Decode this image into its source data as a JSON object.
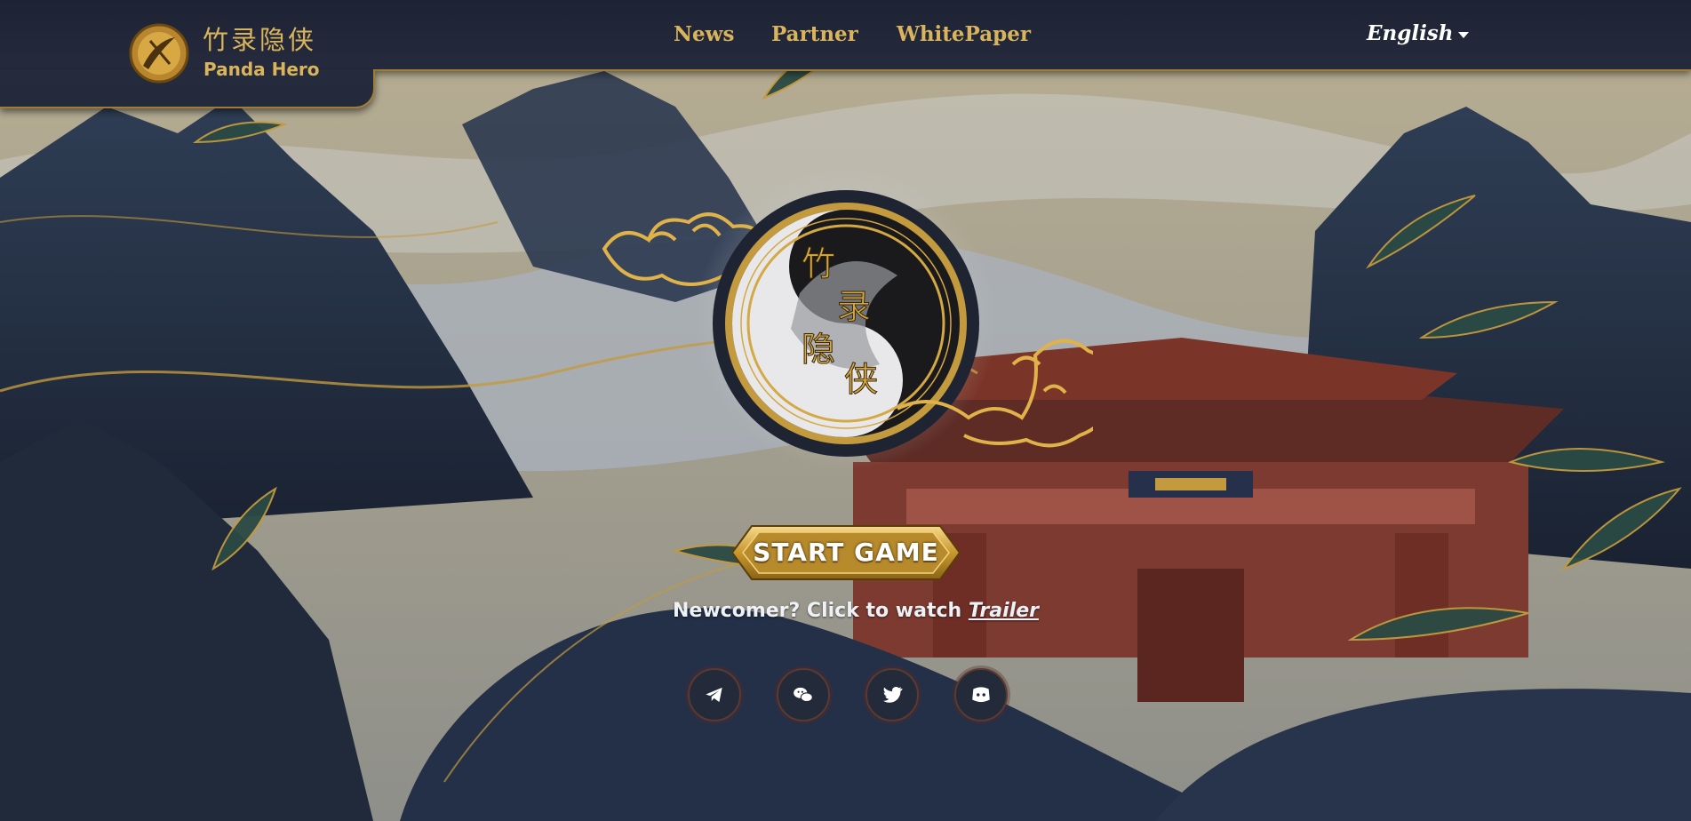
{
  "brand": {
    "name_cn": "竹录隐侠",
    "name_en": "Panda Hero"
  },
  "nav": {
    "links": [
      "News",
      "Partner",
      "WhitePaper"
    ],
    "language": "English"
  },
  "emblem": {
    "characters": [
      "竹",
      "录",
      "隐",
      "侠"
    ]
  },
  "hero": {
    "start_label": "START GAME",
    "newcomer_text": "Newcomer? Click to watch ",
    "trailer_link": "Trailer"
  },
  "social": {
    "icons": [
      "telegram-icon",
      "wechat-icon",
      "twitter-icon",
      "discord-icon"
    ]
  },
  "colors": {
    "gold": "#d9b45c",
    "navy": "#1d2333",
    "temple_red": "#8a3a2e"
  }
}
